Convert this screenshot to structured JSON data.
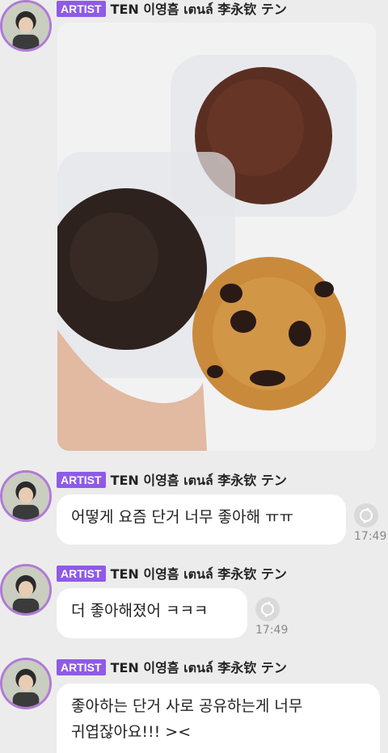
{
  "messages": [
    {
      "badge": "ARTIST",
      "sender": "TEN 이영흠 เตนล์ 李永钦 テン",
      "type": "photo"
    },
    {
      "badge": "ARTIST",
      "sender": "TEN 이영흠 เตนล์ 李永钦 テン",
      "text": "어떻게 요즘 단거 너무 좋아해 ㅠㅠ",
      "time": "17:49"
    },
    {
      "badge": "ARTIST",
      "sender": "TEN 이영흠 เตนล์ 李永钦 テン",
      "text": "더 좋아해졌어 ㅋㅋㅋ",
      "time": "17:49"
    },
    {
      "badge": "ARTIST",
      "sender": "TEN 이영흠 เตนล์ 李永钦 テン",
      "text_line1": "좋아하는 단거 사로 공유하는게 너무",
      "text_line2": "귀엽잖아요!!! ><"
    }
  ],
  "icons": {
    "reaction": "reaction-icon",
    "avatar": "avatar"
  },
  "colors": {
    "badge": "#8f5ae6",
    "avatar_ring": "#b07ad6",
    "background": "#ececec"
  }
}
